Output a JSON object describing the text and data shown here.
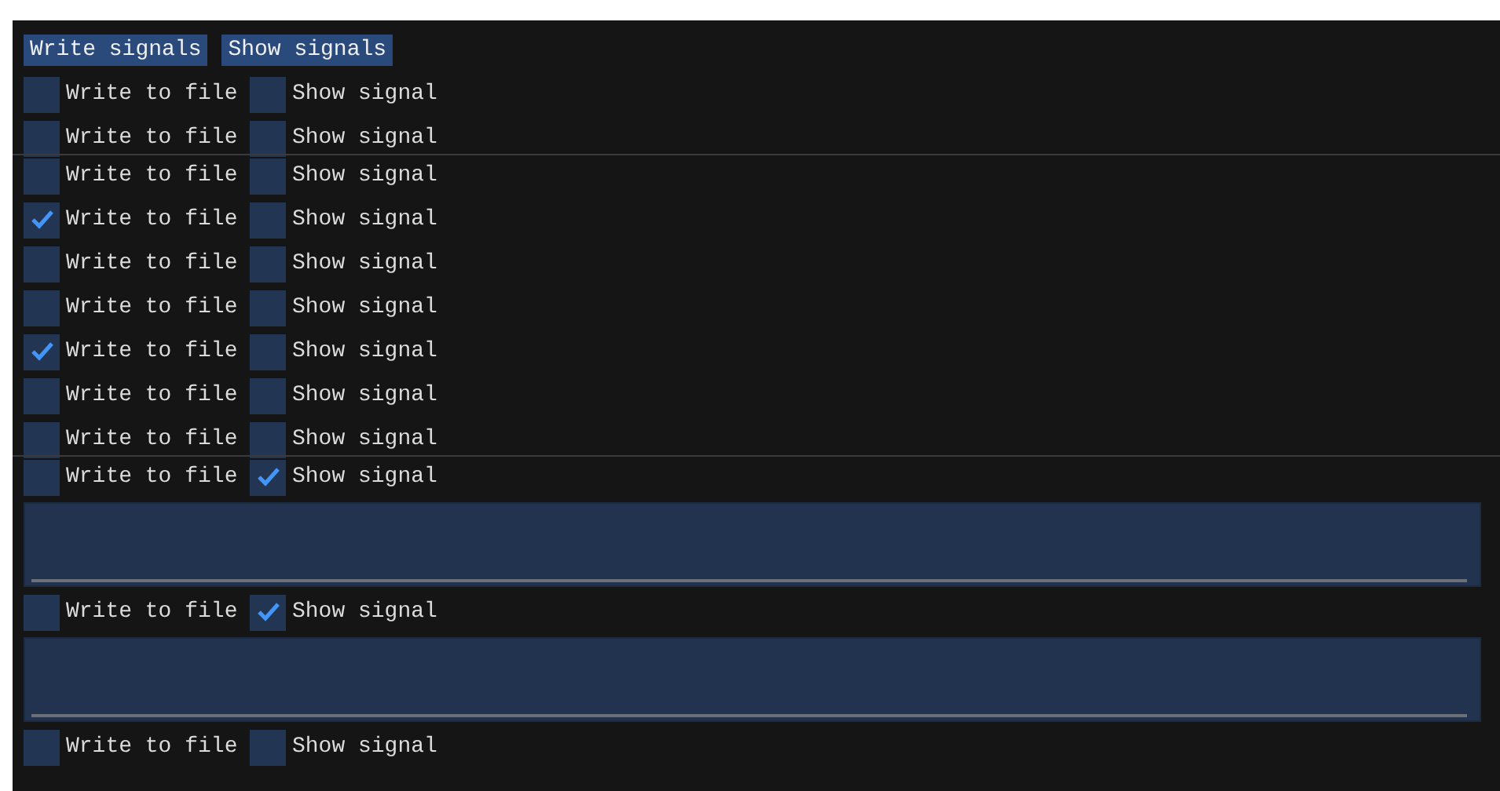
{
  "buttons": [
    "Write signals",
    "Show signals"
  ],
  "groups": [
    {
      "rows": [
        {
          "write_label": "Write to file",
          "write_checked": false,
          "show_label": "Show signal",
          "show_checked": false
        },
        {
          "write_label": "Write to file",
          "write_checked": false,
          "show_label": "Show signal",
          "show_checked": false
        }
      ]
    },
    {
      "rows": [
        {
          "write_label": "Write to file",
          "write_checked": false,
          "show_label": "Show signal",
          "show_checked": false
        },
        {
          "write_label": "Write to file",
          "write_checked": true,
          "show_label": "Show signal",
          "show_checked": false
        },
        {
          "write_label": "Write to file",
          "write_checked": false,
          "show_label": "Show signal",
          "show_checked": false
        },
        {
          "write_label": "Write to file",
          "write_checked": false,
          "show_label": "Show signal",
          "show_checked": false
        },
        {
          "write_label": "Write to file",
          "write_checked": true,
          "show_label": "Show signal",
          "show_checked": false
        },
        {
          "write_label": "Write to file",
          "write_checked": false,
          "show_label": "Show signal",
          "show_checked": false
        },
        {
          "write_label": "Write to file",
          "write_checked": false,
          "show_label": "Show signal",
          "show_checked": false
        }
      ]
    },
    {
      "rows": [
        {
          "write_label": "Write to file",
          "write_checked": false,
          "show_label": "Show signal",
          "show_checked": true
        },
        {
          "write_label": "Write to file",
          "write_checked": false,
          "show_label": "Show signal",
          "show_checked": true
        },
        {
          "write_label": "Write to file",
          "write_checked": false,
          "show_label": "Show signal",
          "show_checked": false
        }
      ]
    }
  ]
}
